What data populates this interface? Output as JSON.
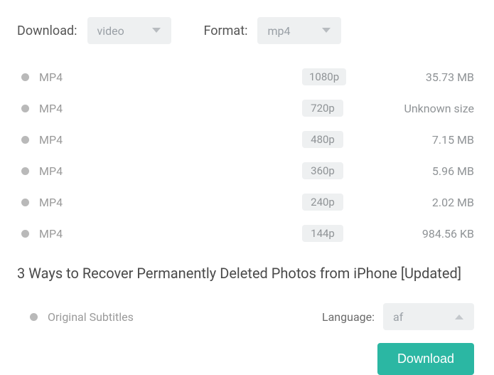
{
  "header": {
    "download_label": "Download:",
    "download_value": "video",
    "format_label": "Format:",
    "format_value": "mp4"
  },
  "rows": [
    {
      "format": "MP4",
      "resolution": "1080p",
      "size": "35.73 MB"
    },
    {
      "format": "MP4",
      "resolution": "720p",
      "size": "Unknown size"
    },
    {
      "format": "MP4",
      "resolution": "480p",
      "size": "7.15 MB"
    },
    {
      "format": "MP4",
      "resolution": "360p",
      "size": "5.96 MB"
    },
    {
      "format": "MP4",
      "resolution": "240p",
      "size": "2.02 MB"
    },
    {
      "format": "MP4",
      "resolution": "144p",
      "size": "984.56 KB"
    }
  ],
  "title": "3 Ways to Recover Permanently Deleted Photos from iPhone [Updated]",
  "subtitles": {
    "label": "Original Subtitles",
    "language_label": "Language:",
    "language_value": "af"
  },
  "actions": {
    "download": "Download"
  }
}
